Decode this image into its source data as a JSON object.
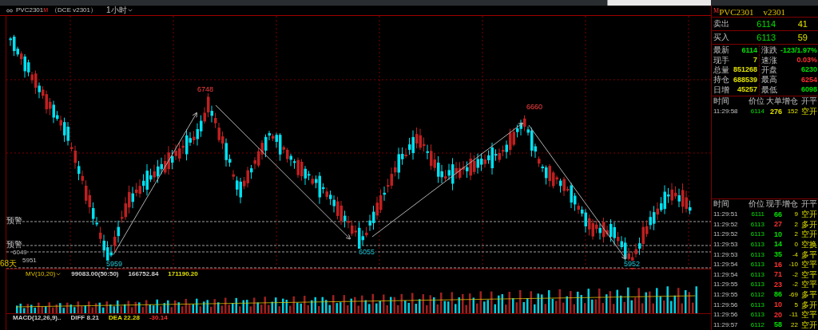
{
  "toolbar": {
    "symbol": "PVC2301",
    "symbol_mark": "M",
    "exchange": "（DCE v2301）",
    "period": "1小时"
  },
  "chart": {
    "peak_labels": [
      {
        "text": "6748",
        "kind": "high"
      },
      {
        "text": "6660",
        "kind": "high"
      },
      {
        "text": "6055",
        "kind": "low"
      },
      {
        "text": "5959",
        "kind": "low"
      },
      {
        "text": "5952",
        "kind": "low"
      }
    ],
    "axis_labels": [
      {
        "text": "预警",
        "kind": "alert"
      },
      {
        "text": "预警",
        "kind": "alert"
      },
      {
        "text": "6049",
        "kind": "price"
      },
      {
        "text": "5951",
        "kind": "price"
      },
      {
        "text": "68天",
        "kind": "count"
      }
    ]
  },
  "volume_panel": {
    "indicator": "MV(10,20)",
    "values": [
      {
        "text": "99083.00(50:50)",
        "color": "#d0d0d0"
      },
      {
        "text": "166752.84",
        "color": "#d0d0d0"
      },
      {
        "text": "171190.20",
        "color": "#e0e000"
      }
    ]
  },
  "macd_panel": {
    "values": [
      {
        "text": "MACD(12,26,9)..",
        "color": "#d0d0d0"
      },
      {
        "text": "DIFF 8.21",
        "color": "#d0d0d0"
      },
      {
        "text": "DEA 22.28",
        "color": "#e0e000"
      },
      {
        "text": "-30.14",
        "color": "#ff3030"
      }
    ]
  },
  "quote": {
    "mark": "M",
    "symbol": "PVC2301",
    "contract": "v2301",
    "book": [
      {
        "label": "卖出",
        "price": "6114",
        "volume": "41"
      },
      {
        "label": "买入",
        "price": "6113",
        "volume": "59"
      }
    ],
    "stats": [
      {
        "label": "最新",
        "value": "6114",
        "color": "#00e000"
      },
      {
        "label": "涨跌",
        "value": "-123/1.97%",
        "color": "#00e000"
      },
      {
        "label": "现手",
        "value": "7",
        "color": "#e0e000"
      },
      {
        "label": "速涨",
        "value": "0.03%",
        "color": "#ff3030"
      },
      {
        "label": "总量",
        "value": "851268",
        "color": "#e0e000"
      },
      {
        "label": "开盘",
        "value": "6230",
        "color": "#00e000"
      },
      {
        "label": "持仓",
        "value": "688539",
        "color": "#e0e000"
      },
      {
        "label": "最高",
        "value": "6254",
        "color": "#ff3030"
      },
      {
        "label": "日增",
        "value": "45257",
        "color": "#e0e000"
      },
      {
        "label": "最低",
        "value": "6098",
        "color": "#00e000"
      }
    ],
    "big_orders": {
      "columns": [
        "时间",
        "价位",
        "大单",
        "增仓",
        "开平"
      ],
      "rows": [
        {
          "time": "11:29:58",
          "price": "6114",
          "volume": "276",
          "color": "#e0e000",
          "change": "152",
          "type": "空开"
        }
      ]
    },
    "ticks": {
      "columns": [
        "时间",
        "价位",
        "现手",
        "增仓",
        "开平"
      ],
      "rows": [
        {
          "time": "11:29:51",
          "price": "6111",
          "volume": "66",
          "color": "#00e000",
          "change": "9",
          "type": "空开"
        },
        {
          "time": "11:29:52",
          "price": "6113",
          "volume": "27",
          "color": "#ff3030",
          "change": "2",
          "type": "多开"
        },
        {
          "time": "11:29:52",
          "price": "6113",
          "volume": "10",
          "color": "#00e000",
          "change": "2",
          "type": "空开"
        },
        {
          "time": "11:29:53",
          "price": "6113",
          "volume": "14",
          "color": "#00e000",
          "change": "0",
          "type": "空换"
        },
        {
          "time": "11:29:53",
          "price": "6113",
          "volume": "35",
          "color": "#00e000",
          "change": "-4",
          "type": "多平"
        },
        {
          "time": "11:29:54",
          "price": "6113",
          "volume": "16",
          "color": "#ff3030",
          "change": "-10",
          "type": "空平"
        },
        {
          "time": "11:29:54",
          "price": "6113",
          "volume": "71",
          "color": "#ff3030",
          "change": "-2",
          "type": "空平"
        },
        {
          "time": "11:29:55",
          "price": "6113",
          "volume": "23",
          "color": "#ff3030",
          "change": "-2",
          "type": "空平"
        },
        {
          "time": "11:29:55",
          "price": "6112",
          "volume": "86",
          "color": "#00e000",
          "change": "-69",
          "type": "多平"
        },
        {
          "time": "11:29:56",
          "price": "6113",
          "volume": "10",
          "color": "#ff3030",
          "change": "5",
          "type": "多开"
        },
        {
          "time": "11:29:56",
          "price": "6113",
          "volume": "20",
          "color": "#ff3030",
          "change": "-11",
          "type": "空平"
        },
        {
          "time": "11:29:57",
          "price": "6112",
          "volume": "58",
          "color": "#00e000",
          "change": "22",
          "type": "空开"
        }
      ]
    }
  }
}
